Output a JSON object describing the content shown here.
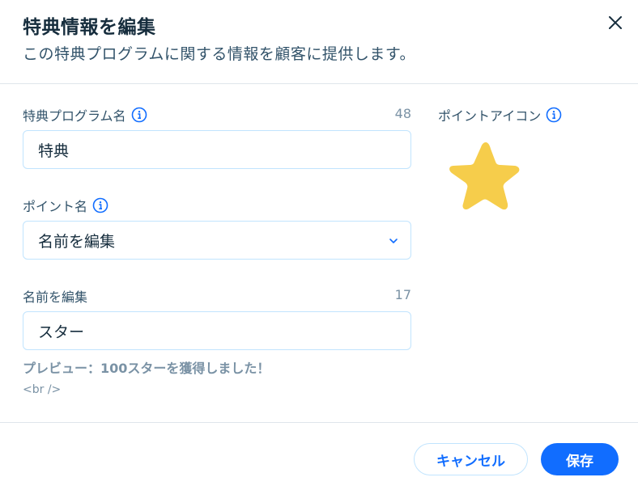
{
  "header": {
    "title": "特典情報を編集",
    "subtitle": "この特典プログラムに関する情報を顧客に提供します。"
  },
  "program_name": {
    "label": "特典プログラム名",
    "counter": "48",
    "value": "特典"
  },
  "point_name": {
    "label": "ポイント名",
    "selected": "名前を編集"
  },
  "edit_name": {
    "label": "名前を編集",
    "counter": "17",
    "value": "スター"
  },
  "preview": {
    "text": "プレビュー：100スターを獲得しました！",
    "br": "<br />"
  },
  "point_icon": {
    "label": "ポイントアイコン",
    "icon": "star-icon",
    "color": "#f6cd4b"
  },
  "footer": {
    "cancel_label": "キャンセル",
    "save_label": "保存"
  },
  "colors": {
    "accent": "#116dff",
    "info": "#116dff",
    "border": "#c1e4fe"
  }
}
